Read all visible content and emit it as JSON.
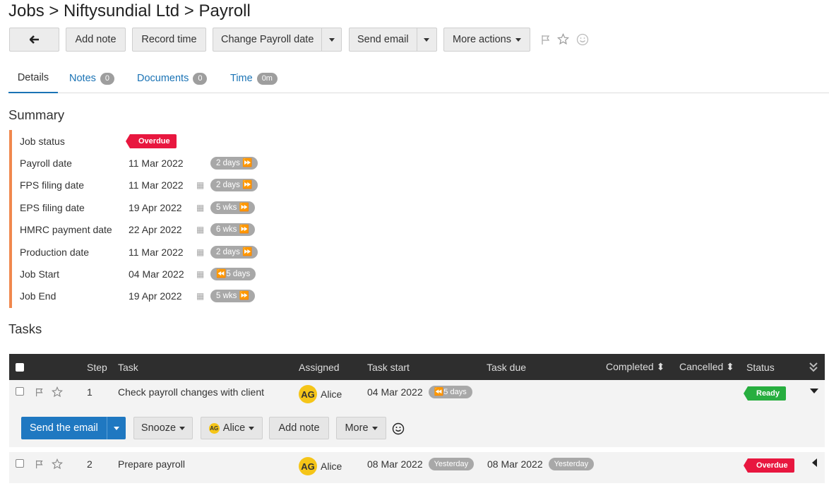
{
  "page": {
    "title": "Jobs > Niftysundial Ltd > Payroll"
  },
  "toolbar": {
    "back_icon": "arrow-left-icon",
    "add_note": "Add note",
    "record_time": "Record time",
    "change_payroll_date": "Change Payroll date",
    "send_email": "Send email",
    "more_actions": "More actions",
    "icons": [
      "flag-icon",
      "star-icon",
      "smiley-icon"
    ]
  },
  "tabs": [
    {
      "label": "Details",
      "count": ""
    },
    {
      "label": "Notes",
      "count": "0"
    },
    {
      "label": "Documents",
      "count": "0"
    },
    {
      "label": "Time",
      "count": "0m"
    }
  ],
  "summary": {
    "title": "Summary",
    "rows": [
      {
        "label": "Job status",
        "value": "",
        "badge": "Overdue"
      },
      {
        "label": "Payroll date",
        "value": "11 Mar 2022",
        "pill": "2 days ⏩"
      },
      {
        "label": "FPS filing date",
        "value": "11 Mar 2022",
        "pill": "2 days ⏩"
      },
      {
        "label": "EPS filing date",
        "value": "19 Apr 2022",
        "pill": "5 wks ⏩"
      },
      {
        "label": "HMRC payment date",
        "value": "22 Apr 2022",
        "pill": "6 wks ⏩"
      },
      {
        "label": "Production date",
        "value": "11 Mar 2022",
        "pill": "2 days ⏩"
      },
      {
        "label": "Job Start",
        "value": "04 Mar 2022",
        "pill": "⏪5 days"
      },
      {
        "label": "Job End",
        "value": "19 Apr 2022",
        "pill": "5 wks ⏩"
      }
    ]
  },
  "tasks": {
    "title": "Tasks",
    "headers": {
      "step": "Step",
      "task": "Task",
      "assigned": "Assigned",
      "task_start": "Task start",
      "task_due": "Task due",
      "completed": "Completed ⬍",
      "cancelled": "Cancelled ⬍",
      "status": "Status"
    },
    "rows": [
      {
        "step": "1",
        "task": "Check payroll changes with client",
        "assignee_initials": "AG",
        "assignee": "Alice",
        "start": "04 Mar 2022",
        "start_pill": "⏪5 days",
        "due": "",
        "due_pill": "",
        "status": "Ready"
      },
      {
        "step": "2",
        "task": "Prepare payroll",
        "assignee_initials": "AG",
        "assignee": "Alice",
        "start": "08 Mar 2022",
        "start_pill": "Yesterday",
        "due": "08 Mar 2022",
        "due_pill": "Yesterday",
        "status": "Overdue"
      }
    ],
    "actions": {
      "send_email": "Send the email",
      "snooze": "Snooze",
      "assignee_initials": "AG",
      "assignee": "Alice",
      "add_note": "Add note",
      "more": "More"
    }
  },
  "colors": {
    "accent": "#1a73b5",
    "primary_button": "#1f78c1",
    "overdue": "#e8173f",
    "ready": "#27ae3f",
    "summary_bar": "#f0884e",
    "table_header": "#2e2e2e"
  }
}
